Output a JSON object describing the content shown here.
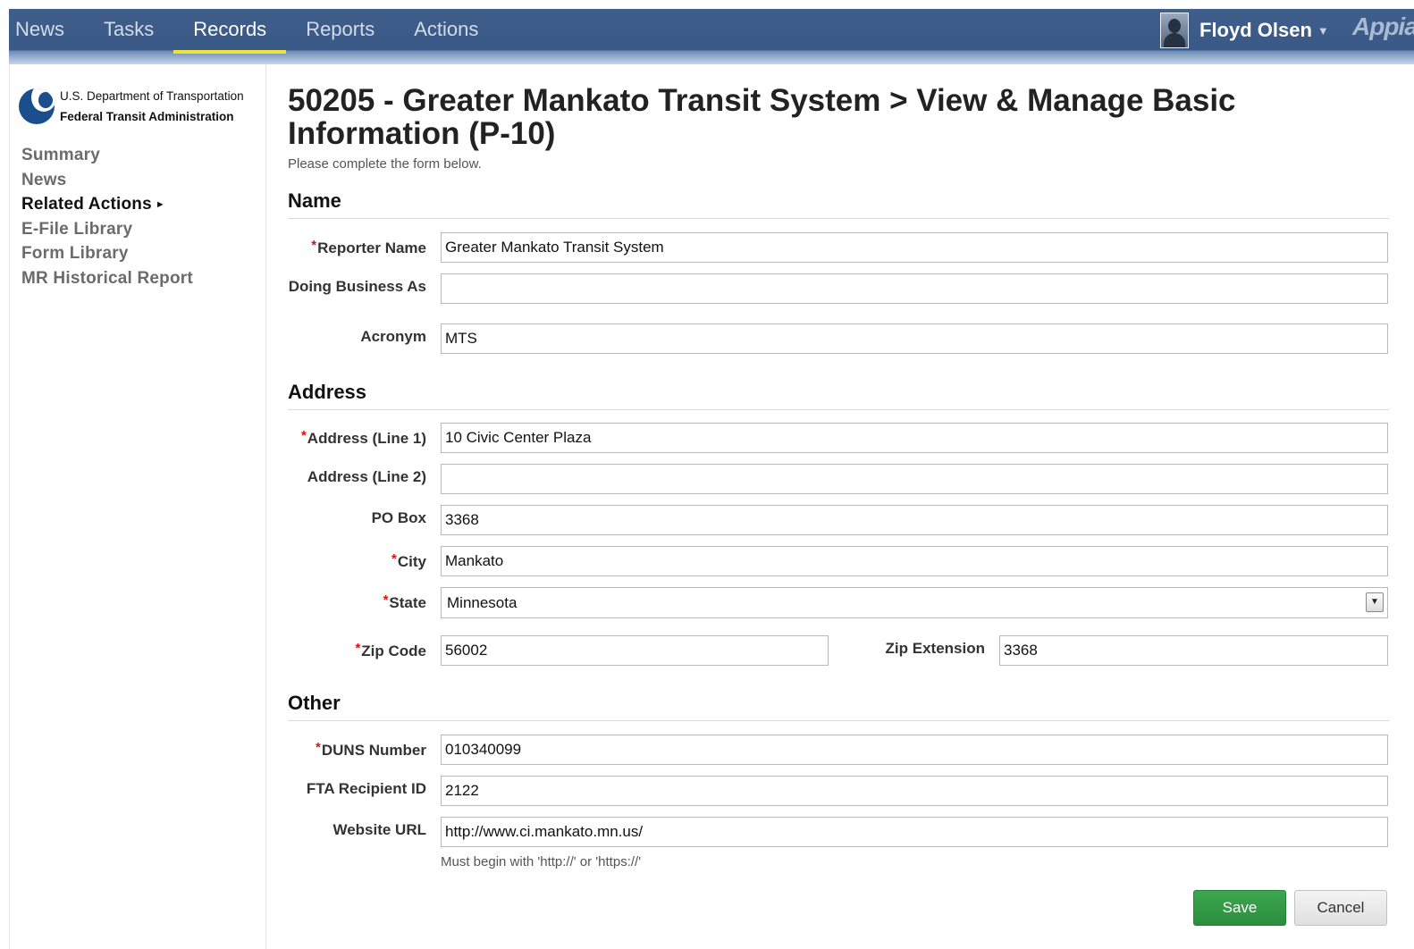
{
  "nav": {
    "items": [
      {
        "label": "News"
      },
      {
        "label": "Tasks"
      },
      {
        "label": "Records"
      },
      {
        "label": "Reports"
      },
      {
        "label": "Actions"
      }
    ],
    "active": "Records",
    "user_name": "Floyd Olsen",
    "brand": "Appia"
  },
  "sidebar": {
    "logo_line1": "U.S. Department of Transportation",
    "logo_line2": "Federal Transit Administration",
    "items": [
      {
        "label": "Summary"
      },
      {
        "label": "News"
      },
      {
        "label": "Related Actions"
      },
      {
        "label": "E-File Library"
      },
      {
        "label": "Form Library"
      },
      {
        "label": "MR Historical Report"
      }
    ],
    "current": "Related Actions"
  },
  "page": {
    "title": "50205 - Greater Mankato Transit System > View & Manage Basic Information (P-10)",
    "instructions": "Please complete the form below."
  },
  "sections": {
    "name": "Name",
    "address": "Address",
    "other": "Other"
  },
  "fields": {
    "reporter_name": {
      "label": "Reporter Name",
      "required": true,
      "value": "Greater Mankato Transit System"
    },
    "doing_business_as": {
      "label": "Doing Business As",
      "required": false,
      "value": ""
    },
    "acronym": {
      "label": "Acronym",
      "required": false,
      "value": "MTS"
    },
    "address_line1": {
      "label": "Address (Line 1)",
      "required": true,
      "value": "10 Civic Center Plaza"
    },
    "address_line2": {
      "label": "Address (Line 2)",
      "required": false,
      "value": ""
    },
    "po_box": {
      "label": "PO Box",
      "required": false,
      "value": "3368"
    },
    "city": {
      "label": "City",
      "required": true,
      "value": "Mankato"
    },
    "state": {
      "label": "State",
      "required": true,
      "value": "Minnesota"
    },
    "zip_code": {
      "label": "Zip Code",
      "required": true,
      "value": "56002"
    },
    "zip_extension": {
      "label": "Zip Extension",
      "required": false,
      "value": "3368"
    },
    "duns_number": {
      "label": "DUNS Number",
      "required": true,
      "value": "010340099"
    },
    "fta_recipient_id": {
      "label": "FTA Recipient ID",
      "required": false,
      "value": "2122"
    },
    "website_url": {
      "label": "Website URL",
      "required": false,
      "value": "http://www.ci.mankato.mn.us/",
      "hint": "Must begin with 'http://' or 'https://'"
    }
  },
  "required_marker": "*",
  "buttons": {
    "save": "Save",
    "cancel": "Cancel"
  },
  "colors": {
    "nav_bar": "#3a5987",
    "nav_active_underline": "#f3e13b",
    "required": "#dd1111",
    "save_button": "#2e9a42"
  }
}
